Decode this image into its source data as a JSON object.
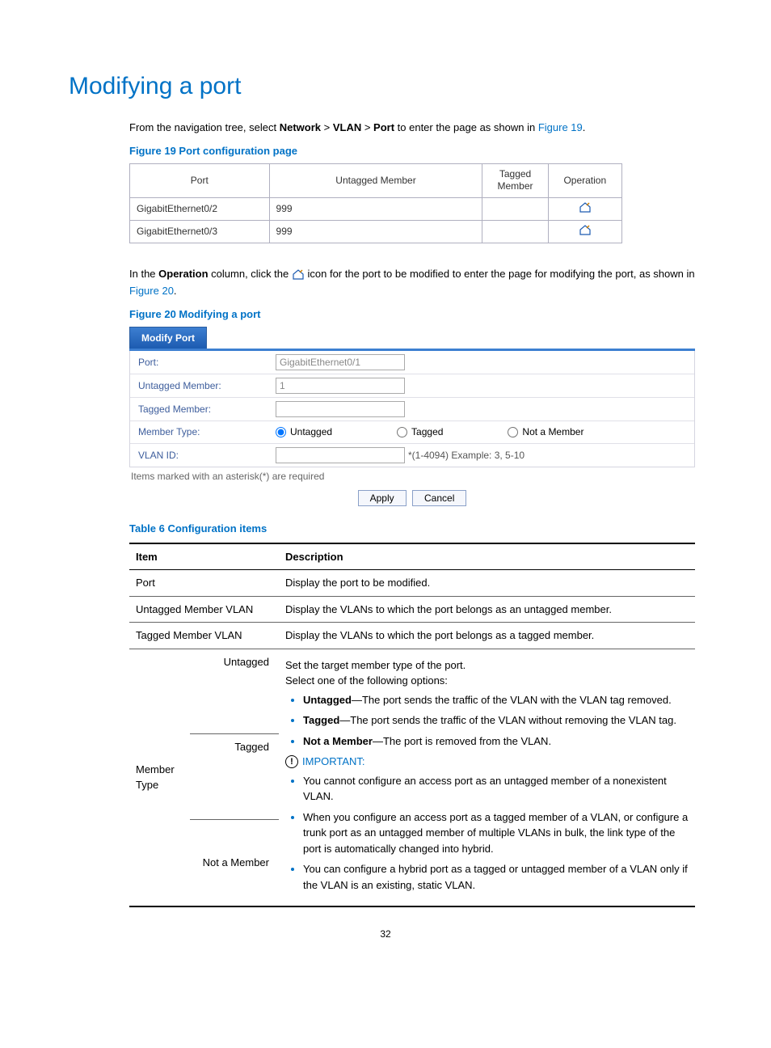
{
  "heading": "Modifying a port",
  "intro": {
    "prefix": "From the navigation tree, select ",
    "b1": "Network",
    "sep": " > ",
    "b2": "VLAN",
    "b3": "Port",
    "mid": " to enter the page as shown in ",
    "link1": "Figure 19",
    "suffix": "."
  },
  "figure19_caption": "Figure 19 Port configuration page",
  "figure19": {
    "headers": {
      "port": "Port",
      "untagged": "Untagged Member",
      "tagged": "Tagged\nMember",
      "operation": "Operation"
    },
    "rows": [
      {
        "port": "GigabitEthernet0/2",
        "untagged": "999",
        "tagged": ""
      },
      {
        "port": "GigabitEthernet0/3",
        "untagged": "999",
        "tagged": ""
      }
    ]
  },
  "operation_para": {
    "p1": "In the ",
    "b1": "Operation",
    "p2": " column, click the ",
    "p3": " icon for the port to be modified to enter the page for modifying the port, as shown in ",
    "link": "Figure 20",
    "suffix": "."
  },
  "figure20_caption": "Figure 20 Modifying a port",
  "modify": {
    "tab": "Modify Port",
    "labels": {
      "port": "Port:",
      "untagged": "Untagged Member:",
      "tagged": "Tagged Member:",
      "member_type": "Member Type:",
      "vlan_id": "VLAN ID:"
    },
    "values": {
      "port": "GigabitEthernet0/1",
      "untagged": "1",
      "tagged": "",
      "vlan_id": ""
    },
    "radios": {
      "untagged": "Untagged",
      "tagged": "Tagged",
      "not_member": "Not a Member"
    },
    "vlan_hint": "*(1-4094) Example: 3, 5-10",
    "note": "Items marked with an asterisk(*) are required",
    "apply": "Apply",
    "cancel": "Cancel"
  },
  "table6_caption": "Table 6 Configuration items",
  "table6": {
    "headers": {
      "item": "Item",
      "desc": "Description"
    },
    "rows": {
      "port": {
        "item": "Port",
        "desc": "Display the port to be modified."
      },
      "untagged_vlan": {
        "item": "Untagged Member VLAN",
        "desc": "Display the VLANs to which the port belongs as an untagged member."
      },
      "tagged_vlan": {
        "item": "Tagged Member VLAN",
        "desc": "Display the VLANs to which the port belongs as a tagged member."
      },
      "member_type": {
        "item_col1": "Member Type",
        "sub_untagged": "Untagged",
        "sub_tagged": "Tagged",
        "sub_not": "Not a Member",
        "intro1": "Set the target member type of the port.",
        "intro2": "Select one of the following options:",
        "bullets": [
          {
            "bold": "Untagged",
            "rest": "—The port sends the traffic of the VLAN with the VLAN tag removed."
          },
          {
            "bold": "Tagged",
            "rest": "—The port sends the traffic of the VLAN without removing the VLAN tag."
          },
          {
            "bold": "Not a Member",
            "rest": "—The port is removed from the VLAN."
          }
        ],
        "important_label": "IMPORTANT:",
        "notes": [
          "You cannot configure an access port as an untagged member of a nonexistent VLAN.",
          "When you configure an access port as a tagged member of a VLAN, or configure a trunk port as an untagged member of multiple VLANs in bulk, the link type of the port is automatically changed into hybrid.",
          "You can configure a hybrid port as a tagged or untagged member of a VLAN only if the VLAN is an existing, static VLAN."
        ]
      }
    }
  },
  "page_number": "32"
}
